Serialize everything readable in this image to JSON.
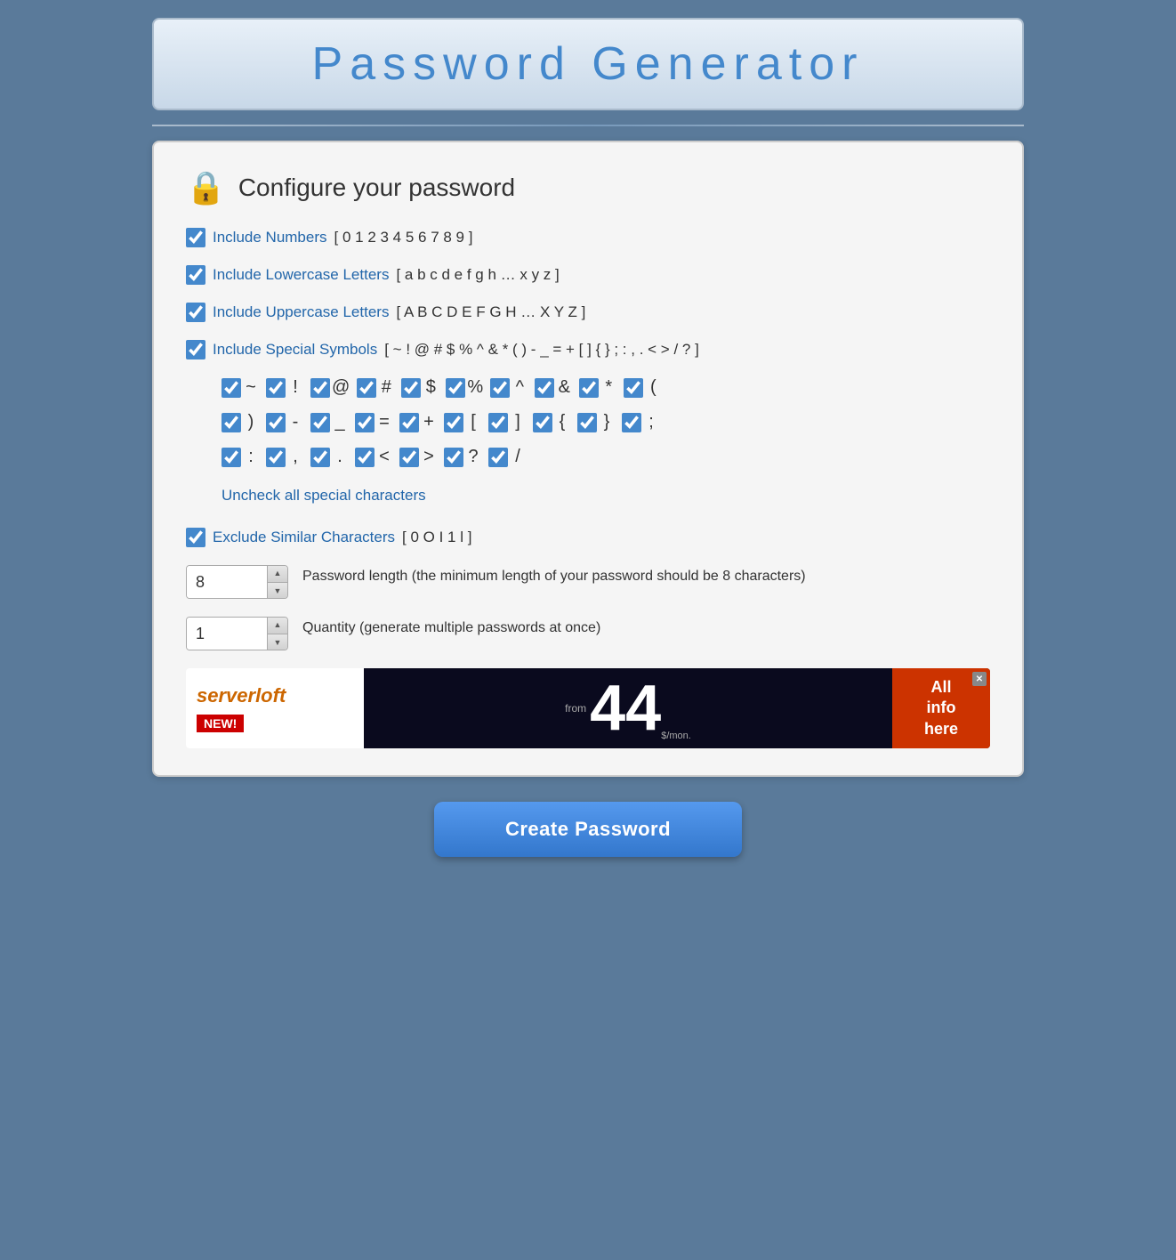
{
  "header": {
    "title": "Password Generator"
  },
  "configure": {
    "icon": "🔒",
    "title": "Configure your password"
  },
  "options": {
    "numbers": {
      "label": "Include Numbers",
      "chars": "[ 0 1 2 3 4 5 6 7 8 9 ]",
      "checked": true
    },
    "lowercase": {
      "label": "Include Lowercase Letters",
      "chars": "[ a b c d e f g h … x y z ]",
      "checked": true
    },
    "uppercase": {
      "label": "Include Uppercase Letters",
      "chars": "[ A B C D E F G H … X Y Z ]",
      "checked": true
    },
    "special": {
      "label": "Include Special Symbols",
      "chars": "[ ~ ! @ # $ % ^ & * ( ) - _ = + [ ] { } ; : , . < > / ? ]",
      "checked": true
    }
  },
  "special_chars": {
    "row1": [
      "~",
      "!",
      "@",
      "#",
      "$",
      "%",
      "^",
      "&",
      "*",
      "("
    ],
    "row2": [
      ")",
      "-",
      "_",
      "=",
      "+",
      "[",
      "]",
      "{",
      "}",
      ";"
    ],
    "row3": [
      ":",
      ",",
      ".",
      "<",
      ">",
      "?",
      "/"
    ]
  },
  "uncheck_label": "Uncheck all special characters",
  "exclude": {
    "label": "Exclude Similar Characters",
    "chars": "[ 0 O I 1 l ]",
    "checked": true
  },
  "password_length": {
    "value": "8",
    "label": "Password length (the minimum length of your password should be 8 characters)"
  },
  "quantity": {
    "value": "1",
    "label": "Quantity (generate multiple passwords at once)"
  },
  "create_button": {
    "label": "Create Password"
  },
  "ad": {
    "brand": "serverloft",
    "badge": "NEW!",
    "price_prefix": "from",
    "price": "44",
    "price_unit": "$/mon.",
    "cta_line1": "All",
    "cta_line2": "info",
    "cta_line3": "here"
  }
}
